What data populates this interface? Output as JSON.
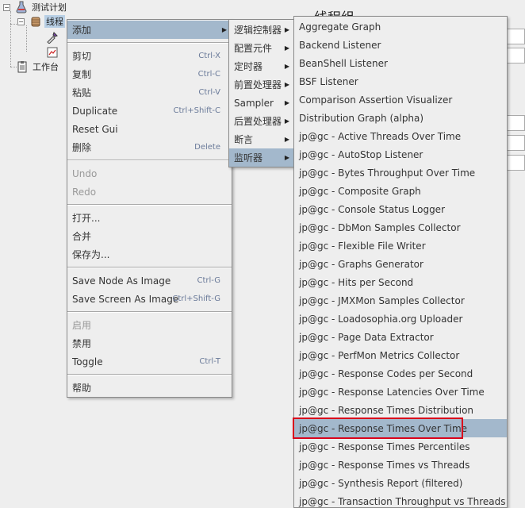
{
  "tree": {
    "test_plan": "测试计划",
    "thread_group": "线程",
    "workbench": "工作台"
  },
  "right_panel": {
    "title": "线程组"
  },
  "context_menu": {
    "items": [
      {
        "label": "添加",
        "submenu": true,
        "selected": true
      },
      {
        "sep": true
      },
      {
        "label": "剪切",
        "accel": "Ctrl-X"
      },
      {
        "label": "复制",
        "accel": "Ctrl-C"
      },
      {
        "label": "粘贴",
        "accel": "Ctrl-V"
      },
      {
        "label": "Duplicate",
        "accel": "Ctrl+Shift-C"
      },
      {
        "label": "Reset Gui"
      },
      {
        "label": "删除",
        "accel": "Delete"
      },
      {
        "sep": true
      },
      {
        "label": "Undo",
        "disabled": true
      },
      {
        "label": "Redo",
        "disabled": true
      },
      {
        "sep": true
      },
      {
        "label": "打开..."
      },
      {
        "label": "合并"
      },
      {
        "label": "保存为..."
      },
      {
        "sep": true
      },
      {
        "label": "Save Node As Image",
        "accel": "Ctrl-G"
      },
      {
        "label": "Save Screen As Image",
        "accel": "Ctrl+Shift-G"
      },
      {
        "sep": true
      },
      {
        "label": "启用",
        "disabled": true
      },
      {
        "label": "禁用"
      },
      {
        "label": "Toggle",
        "accel": "Ctrl-T"
      },
      {
        "sep": true
      },
      {
        "label": "帮助"
      }
    ]
  },
  "add_submenu": {
    "items": [
      {
        "label": "逻辑控制器"
      },
      {
        "label": "配置元件"
      },
      {
        "label": "定时器"
      },
      {
        "label": "前置处理器"
      },
      {
        "label": "Sampler"
      },
      {
        "label": "后置处理器"
      },
      {
        "label": "断言"
      },
      {
        "label": "监听器",
        "selected": true
      }
    ]
  },
  "listener_submenu": {
    "items": [
      {
        "label": "Aggregate Graph"
      },
      {
        "label": "Backend Listener"
      },
      {
        "label": "BeanShell Listener"
      },
      {
        "label": "BSF Listener"
      },
      {
        "label": "Comparison Assertion Visualizer"
      },
      {
        "label": "Distribution Graph (alpha)"
      },
      {
        "label": "jp@gc - Active Threads Over Time"
      },
      {
        "label": "jp@gc - AutoStop Listener"
      },
      {
        "label": "jp@gc - Bytes Throughput Over Time"
      },
      {
        "label": "jp@gc - Composite Graph"
      },
      {
        "label": "jp@gc - Console Status Logger"
      },
      {
        "label": "jp@gc - DbMon Samples Collector"
      },
      {
        "label": "jp@gc - Flexible File Writer"
      },
      {
        "label": "jp@gc - Graphs Generator"
      },
      {
        "label": "jp@gc - Hits per Second"
      },
      {
        "label": "jp@gc - JMXMon Samples Collector"
      },
      {
        "label": "jp@gc - Loadosophia.org Uploader"
      },
      {
        "label": "jp@gc - Page Data Extractor"
      },
      {
        "label": "jp@gc - PerfMon Metrics Collector"
      },
      {
        "label": "jp@gc - Response Codes per Second"
      },
      {
        "label": "jp@gc - Response Latencies Over Time"
      },
      {
        "label": "jp@gc - Response Times Distribution"
      },
      {
        "label": "jp@gc - Response Times Over Time",
        "selected": true
      },
      {
        "label": "jp@gc - Response Times Percentiles"
      },
      {
        "label": "jp@gc - Response Times vs Threads"
      },
      {
        "label": "jp@gc - Synthesis Report (filtered)"
      },
      {
        "label": "jp@gc - Transaction Throughput vs Threads"
      }
    ]
  },
  "colors": {
    "menu_bg": "#eeeeee",
    "selection": "#a3b8cc",
    "annotation_red": "#d9001b"
  }
}
